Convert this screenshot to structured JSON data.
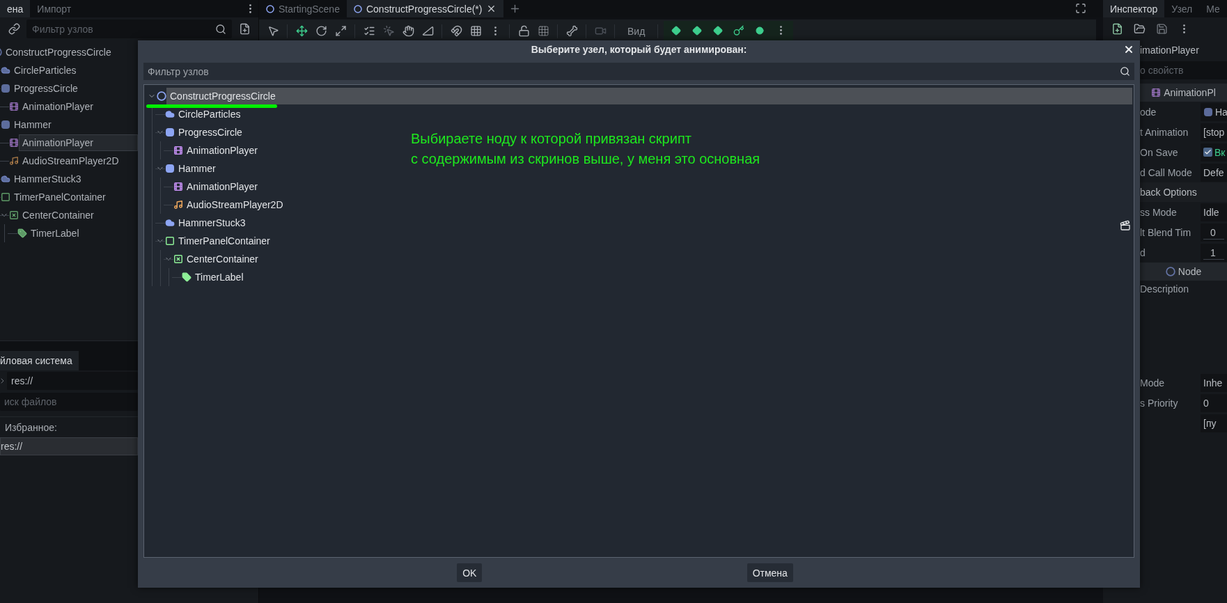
{
  "left_dock": {
    "tabs": [
      {
        "label": "ена",
        "selected": true
      },
      {
        "label": "Импорт",
        "selected": false
      }
    ],
    "filter": {
      "placeholder": "Фильтр узлов"
    },
    "scene_tree": [
      {
        "name": "ConstructProgressCircle",
        "kind": "node",
        "selected": false,
        "children": [
          {
            "name": "CircleParticles",
            "kind": "particles",
            "selected": false
          },
          {
            "name": "ProgressCircle",
            "kind": "sprite",
            "selected": false,
            "children": [
              {
                "name": "AnimationPlayer",
                "kind": "animation",
                "selected": false
              }
            ]
          },
          {
            "name": "Hammer",
            "kind": "sprite",
            "selected": false,
            "children": [
              {
                "name": "AnimationPlayer",
                "kind": "animation",
                "selected": true
              },
              {
                "name": "AudioStreamPlayer2D",
                "kind": "audio",
                "selected": false
              }
            ]
          },
          {
            "name": "HammerStuck3",
            "kind": "particles",
            "selected": false
          },
          {
            "name": "TimerPanelContainer",
            "kind": "panel",
            "selected": false,
            "children": [
              {
                "name": "CenterContainer",
                "kind": "center",
                "selected": false,
                "expanded": true,
                "children": [
                  {
                    "name": "TimerLabel",
                    "kind": "label",
                    "selected": false
                  }
                ]
              }
            ]
          }
        ]
      }
    ]
  },
  "filesystem": {
    "tabs": [
      {
        "label": "йловая система",
        "selected": true
      }
    ],
    "path": "res://",
    "search": {
      "placeholder": "иск файлов"
    },
    "favorites": {
      "label": "Избранное:",
      "items": [
        {
          "label": "res://",
          "selected": true
        }
      ]
    }
  },
  "editor": {
    "tabs": [
      {
        "label": "StartingScene",
        "selected": false
      },
      {
        "label": "ConstructProgressCircle(*)",
        "selected": true
      }
    ],
    "view_menu": "Вид"
  },
  "inspector": {
    "tabs": [
      {
        "label": "Инспектор",
        "selected": true
      },
      {
        "label": "Узел",
        "selected": false
      },
      {
        "label": "Ме",
        "selected": false
      }
    ],
    "object": "imationPlayer",
    "filter": {
      "placeholder": "о свойств"
    },
    "rows": [
      {
        "kind": "animation_section",
        "label": "AnimationPl"
      },
      {
        "kind": "node_property",
        "label": "ode",
        "value": "Ha"
      },
      {
        "kind": "property",
        "label": "t Animation",
        "value": "[stop"
      },
      {
        "kind": "check_property",
        "label": "On Save",
        "value": "Вк",
        "checked": true
      },
      {
        "kind": "property",
        "label": "d Call Mode",
        "value": "Defe"
      },
      {
        "kind": "group",
        "label": "back Options"
      },
      {
        "kind": "property",
        "label": "ss Mode",
        "value": "Idle"
      },
      {
        "kind": "number_property",
        "label": "lt Blend Tim",
        "value": "0"
      },
      {
        "kind": "number_property",
        "label": "d",
        "value": "1"
      },
      {
        "kind": "node_section",
        "label": "Node"
      },
      {
        "kind": "description",
        "label": "Description"
      },
      {
        "kind": "property",
        "label": "Mode",
        "value": "Inhe"
      },
      {
        "kind": "property",
        "label": "s Priority",
        "value": "0"
      },
      {
        "kind": "value_only",
        "value": "[пу"
      }
    ]
  },
  "dialog": {
    "title": "Выберите узел, который будет анимирован:",
    "filter": {
      "placeholder": "Фильтр узлов"
    },
    "tree": [
      {
        "name": "ConstructProgressCircle",
        "kind": "node",
        "selected": true,
        "expanded": true,
        "children": [
          {
            "name": "CircleParticles",
            "kind": "particles",
            "selected": false
          },
          {
            "name": "ProgressCircle",
            "kind": "sprite",
            "selected": false,
            "expanded": true,
            "children": [
              {
                "name": "AnimationPlayer",
                "kind": "animation",
                "selected": false
              }
            ]
          },
          {
            "name": "Hammer",
            "kind": "sprite",
            "selected": false,
            "expanded": true,
            "children": [
              {
                "name": "AnimationPlayer",
                "kind": "animation",
                "selected": false
              },
              {
                "name": "AudioStreamPlayer2D",
                "kind": "audio",
                "selected": false
              }
            ]
          },
          {
            "name": "HammerStuck3",
            "kind": "particles",
            "selected": false
          },
          {
            "name": "TimerPanelContainer",
            "kind": "panel",
            "selected": false,
            "expanded": true,
            "children": [
              {
                "name": "CenterContainer",
                "kind": "center",
                "selected": false,
                "expanded": true,
                "children": [
                  {
                    "name": "TimerLabel",
                    "kind": "label",
                    "selected": false
                  }
                ]
              }
            ]
          }
        ]
      }
    ],
    "annotation": [
      "Выбираете ноду к которой привязан скрипт",
      "с содержимым из скринов выше, у меня это основная"
    ],
    "buttons": [
      "OK",
      "Отмена"
    ]
  }
}
